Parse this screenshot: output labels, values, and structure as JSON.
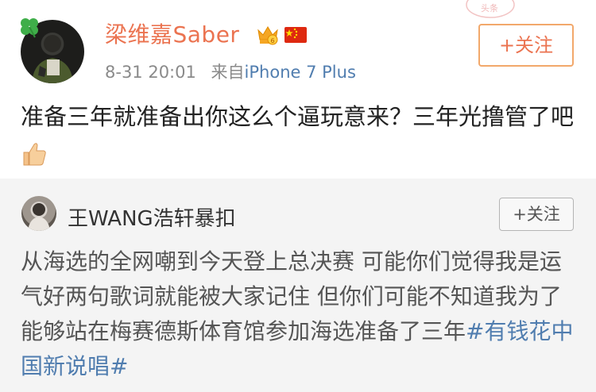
{
  "post": {
    "author": "梁维嘉Saber",
    "timestamp": "8-31 20:01",
    "source_prefix": "来自",
    "source_device": "iPhone 7 Plus",
    "follow_label": "+关注",
    "text": "准备三年就准备出你这么个逼玩意来？三年光撸管了吧",
    "badges": [
      "crown-vip-icon",
      "china-flag-icon"
    ],
    "emoji": "thumbs-up-icon",
    "accent_color": "#eb7350"
  },
  "repost": {
    "author": "王WANG浩轩暴扣",
    "follow_label": "+关注",
    "text": "从海选的全网嘲到今天登上总决赛 可能你们觉得我是运气好两句歌词就能被大家记住 但你们可能不知道我为了能够站在梅赛德斯体育馆参加海选准备了三年",
    "topic": "#有钱花中国新说唱#",
    "link_color": "#507daf"
  },
  "watermark": {
    "text": "头条"
  }
}
